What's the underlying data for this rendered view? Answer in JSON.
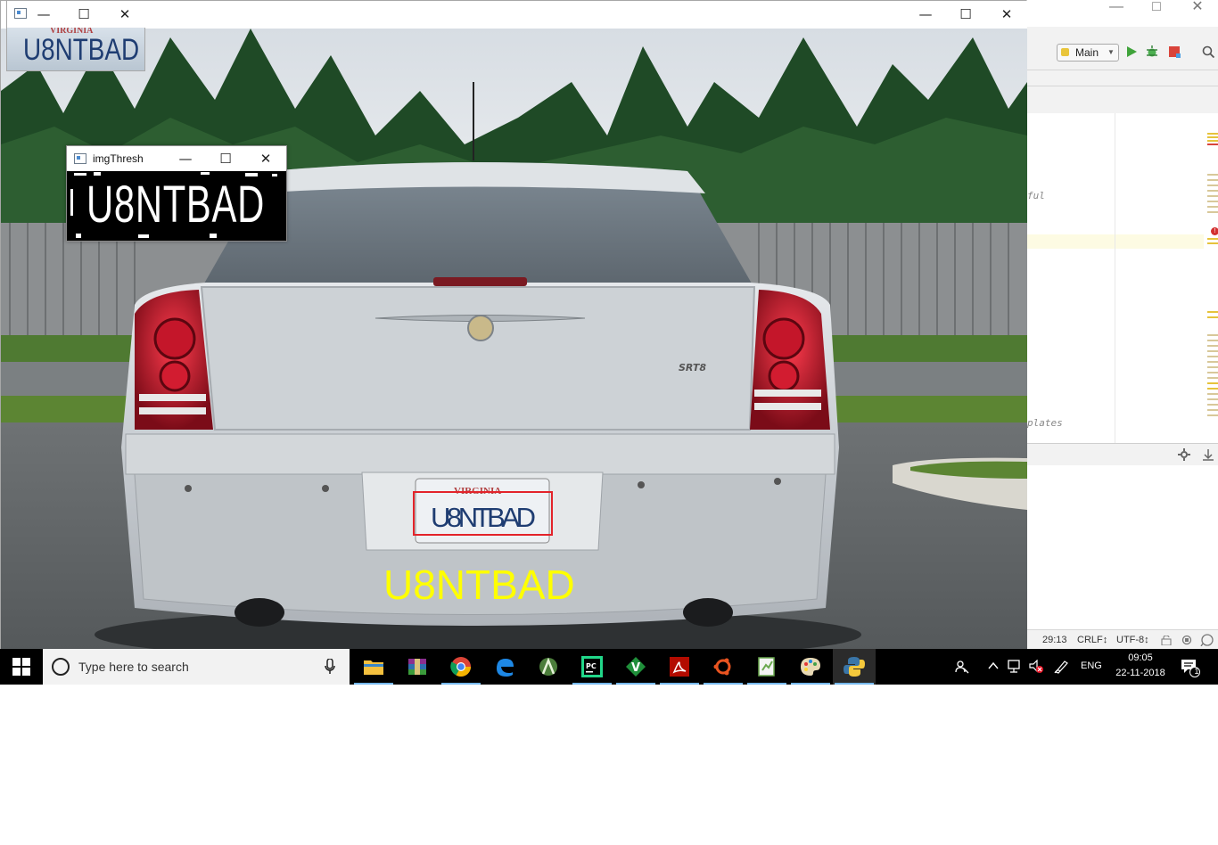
{
  "main_window": {
    "title": ""
  },
  "plate_window": {
    "title": "",
    "plate_text": "U8NTBAD",
    "state_text": "VIRGINIA"
  },
  "thresh_window": {
    "title": "imgThresh",
    "plate_text": "U8NTBAD"
  },
  "scene": {
    "recognized_text": "U8NTBAD",
    "plate_state": "VIRGINIA",
    "plate_text": "U8NTBAD",
    "badge_text": "SRT8"
  },
  "ide": {
    "run_config": "Main",
    "code_fragment_1": "ful",
    "code_fragment_2": "plates",
    "status": {
      "position": "29:13",
      "line_sep": "CRLF↕",
      "encoding": "UTF-8↕"
    }
  },
  "taskbar": {
    "search_placeholder": "Type here to search",
    "apps": [
      "file-explorer",
      "winrar",
      "chrome",
      "edge",
      "android-studio",
      "pycharm",
      "vim",
      "acrobat",
      "ubuntu",
      "notepad-plus",
      "paint",
      "python"
    ],
    "language": "ENG",
    "time": "09:05",
    "date": "22-11-2018",
    "notification_count": "1"
  },
  "colors": {
    "detection_box": "#e3232a",
    "recognized_text": "#ffff00",
    "taskbar": "#000000",
    "accent": "#76b9ed"
  }
}
